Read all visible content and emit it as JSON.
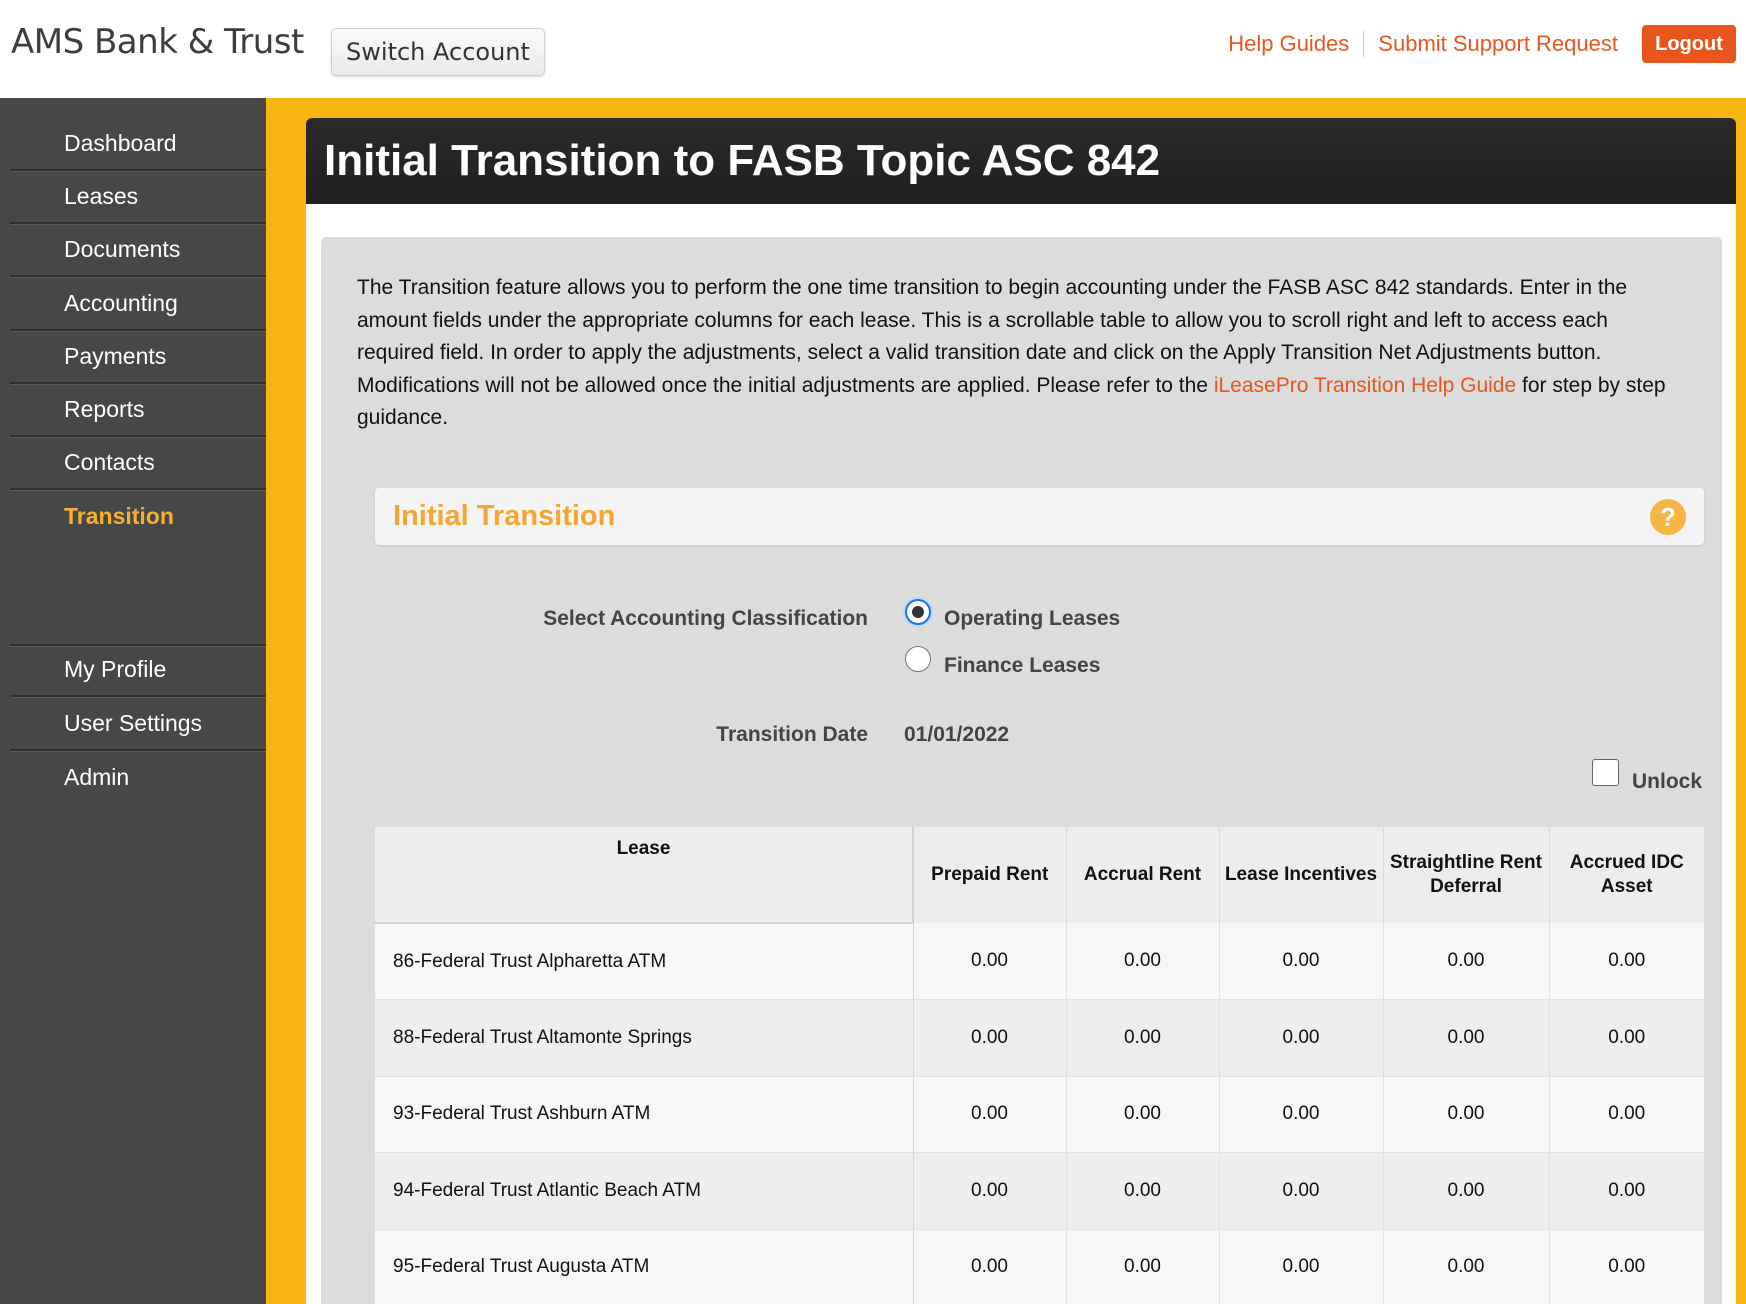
{
  "header": {
    "brand": "AMS Bank & Trust",
    "switch_account": "Switch Account",
    "links": {
      "help_guides": "Help Guides",
      "support": "Submit Support Request"
    },
    "logout": "Logout",
    "accent_color": "#e8561d"
  },
  "sidebar": {
    "items": [
      {
        "label": "Dashboard"
      },
      {
        "label": "Leases"
      },
      {
        "label": "Documents"
      },
      {
        "label": "Accounting"
      },
      {
        "label": "Payments"
      },
      {
        "label": "Reports"
      },
      {
        "label": "Contacts"
      },
      {
        "label": "Transition",
        "active": true
      }
    ],
    "lower_items": [
      {
        "label": "My Profile"
      },
      {
        "label": "User Settings"
      },
      {
        "label": "Admin"
      }
    ]
  },
  "page": {
    "title": "Initial Transition to FASB Topic ASC 842",
    "intro_text": "The Transition feature allows you to perform the one time transition to begin accounting under the FASB ASC 842 standards. Enter in the amount fields under the appropriate columns for each lease. This is a scrollable table to allow you to scroll right and left to access each required field. In order to apply the adjustments, select a valid transition date and click on the Apply Transition Net Adjustments button. Modifications will not be allowed once the initial adjustments are applied. Please refer to the ",
    "intro_link": "iLeasePro Transition Help Guide",
    "intro_suffix": " for step by step guidance."
  },
  "section": {
    "title": "Initial Transition",
    "help_icon": "question-icon"
  },
  "form": {
    "classification_label": "Select Accounting Classification",
    "options": [
      {
        "label": "Operating Leases",
        "checked": true
      },
      {
        "label": "Finance Leases",
        "checked": false
      }
    ],
    "transition_date_label": "Transition Date",
    "transition_date_value": "01/01/2022",
    "unlock_label": "Unlock",
    "unlock_checked": false
  },
  "table": {
    "columns": [
      "Lease",
      "Prepaid Rent",
      "Accrual Rent",
      "Lease Incentives",
      "Straightline Rent Deferral",
      "Accrued IDC Asset"
    ],
    "rows": [
      {
        "lease": "86-Federal Trust Alpharetta ATM",
        "values": [
          "0.00",
          "0.00",
          "0.00",
          "0.00",
          "0.00"
        ]
      },
      {
        "lease": "88-Federal Trust Altamonte Springs",
        "values": [
          "0.00",
          "0.00",
          "0.00",
          "0.00",
          "0.00"
        ]
      },
      {
        "lease": "93-Federal Trust Ashburn ATM",
        "values": [
          "0.00",
          "0.00",
          "0.00",
          "0.00",
          "0.00"
        ]
      },
      {
        "lease": "94-Federal Trust Atlantic Beach ATM",
        "values": [
          "0.00",
          "0.00",
          "0.00",
          "0.00",
          "0.00"
        ]
      },
      {
        "lease": "95-Federal Trust Augusta ATM",
        "values": [
          "0.00",
          "0.00",
          "0.00",
          "0.00",
          "0.00"
        ]
      }
    ]
  }
}
